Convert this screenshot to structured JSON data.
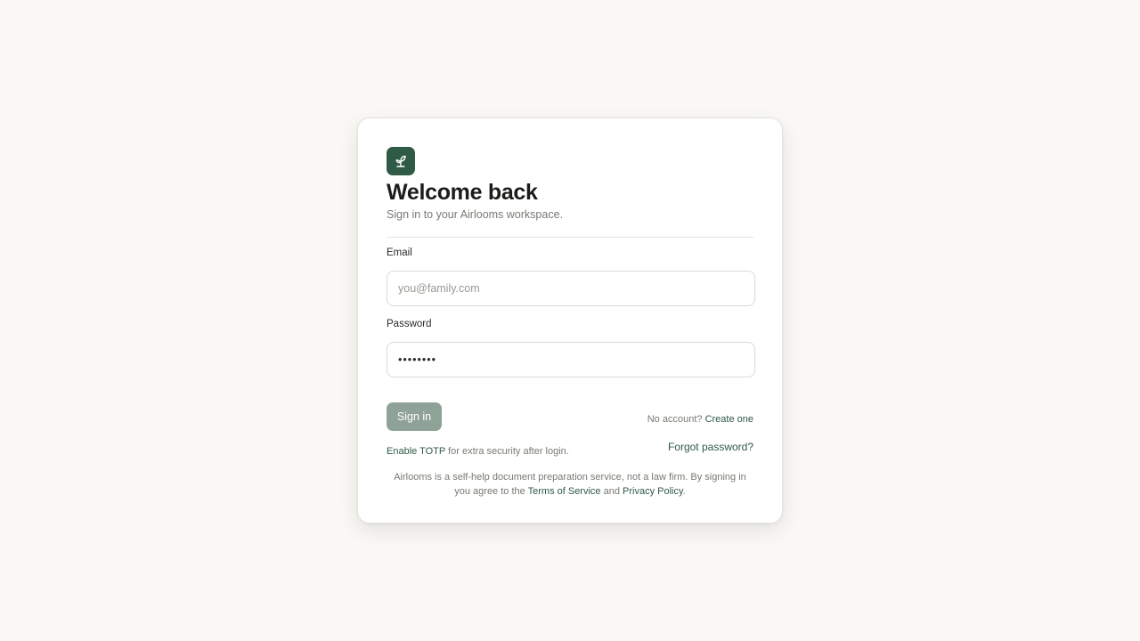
{
  "brand": {
    "logo_icon": "sprout-icon",
    "color": "#2f5a46"
  },
  "header": {
    "title": "Welcome back",
    "subtitle": "Sign in to your Airlooms workspace."
  },
  "form": {
    "email": {
      "label": "Email",
      "placeholder": "you@family.com",
      "value": ""
    },
    "password": {
      "label": "Password",
      "value": "••••••••"
    },
    "submit_label": "Sign in",
    "submit_color": "#8fa297"
  },
  "signup": {
    "prompt": "No account?",
    "link": "Create one"
  },
  "security": {
    "totp_link": "Enable TOTP",
    "totp_text": "for extra security after login.",
    "forgot_link": "Forgot password?"
  },
  "legal": {
    "text_before": "Airlooms is a self-help document preparation service, not a law firm. By signing in you agree to the",
    "terms_link": "Terms of Service",
    "and": "and",
    "privacy_link": "Privacy Policy",
    "period": "."
  }
}
